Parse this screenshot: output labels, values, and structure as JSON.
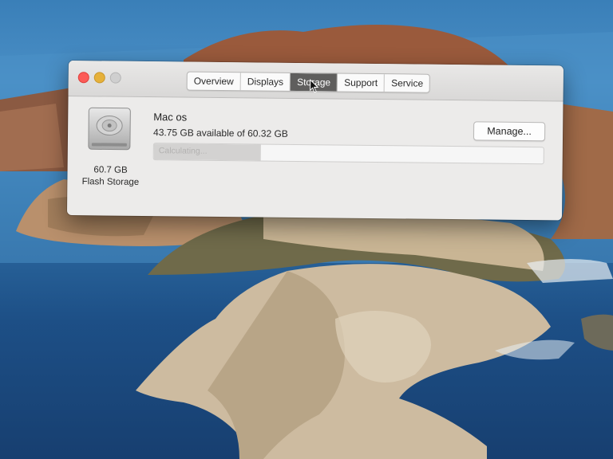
{
  "window": {
    "tabs": [
      {
        "label": "Overview",
        "active": false
      },
      {
        "label": "Displays",
        "active": false
      },
      {
        "label": "Storage",
        "active": true
      },
      {
        "label": "Support",
        "active": false
      },
      {
        "label": "Service",
        "active": false
      }
    ]
  },
  "disk": {
    "icon": "hard-drive-icon",
    "size": "60.7 GB",
    "type": "Flash Storage"
  },
  "volume": {
    "name": "Mac os",
    "available": "43.75 GB available of 60.32 GB",
    "bar_label": "Calculating...",
    "used_fraction": 0.275
  },
  "actions": {
    "manage_label": "Manage..."
  },
  "colors": {
    "close": "#fc5b57",
    "minimize": "#e6b13a",
    "active_tab": "#5f5e5d"
  }
}
